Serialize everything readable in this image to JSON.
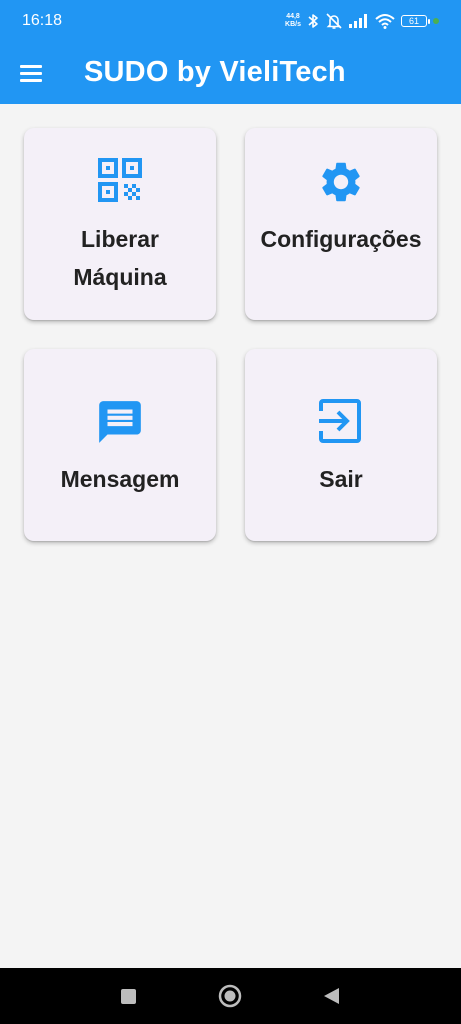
{
  "status_bar": {
    "time": "16:18",
    "net_speed_value": "44,8",
    "net_speed_unit": "KB/s",
    "battery_level": "61",
    "icons": [
      "bluetooth-icon",
      "mute-icon",
      "signal-icon",
      "wifi-icon",
      "battery-icon"
    ]
  },
  "app_bar": {
    "title": "SUDO by VieliTech",
    "menu_icon": "menu-icon",
    "background": "#2196f3"
  },
  "cards": [
    {
      "label": "Liberar Máquina",
      "icon": "qr-code-icon"
    },
    {
      "label": "Configurações",
      "icon": "settings-gear-icon"
    },
    {
      "label": "Mensagem",
      "icon": "message-icon"
    },
    {
      "label": "Sair",
      "icon": "exit-icon"
    }
  ],
  "navigation_bar": {
    "buttons": [
      "recent-apps-button",
      "home-button",
      "back-button"
    ]
  },
  "colors": {
    "accent": "#2196f3",
    "card_background": "#f4f0f8",
    "page_background": "#f4f4f4"
  }
}
